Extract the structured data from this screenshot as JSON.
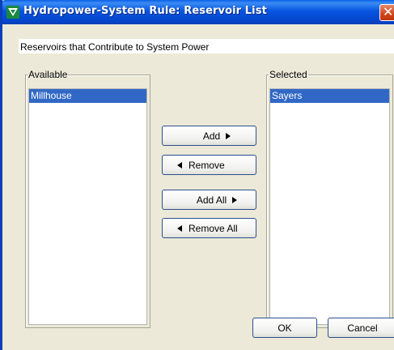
{
  "window": {
    "title": "Hydropower-System Rule: Reservoir List",
    "close_glyph": "✕"
  },
  "heading": "Reservoirs that Contribute to System Power",
  "available": {
    "label": "Available",
    "items": [
      "Millhouse"
    ]
  },
  "selected": {
    "label": "Selected",
    "items": [
      "Sayers"
    ]
  },
  "buttons": {
    "add": "Add",
    "remove": "Remove",
    "add_all": "Add All",
    "remove_all": "Remove All",
    "ok": "OK",
    "cancel": "Cancel"
  },
  "colors": {
    "titlebar": "#0755e0",
    "selection": "#3168c6",
    "dialog_bg": "#ece9d8",
    "close_button": "#d2451a"
  }
}
